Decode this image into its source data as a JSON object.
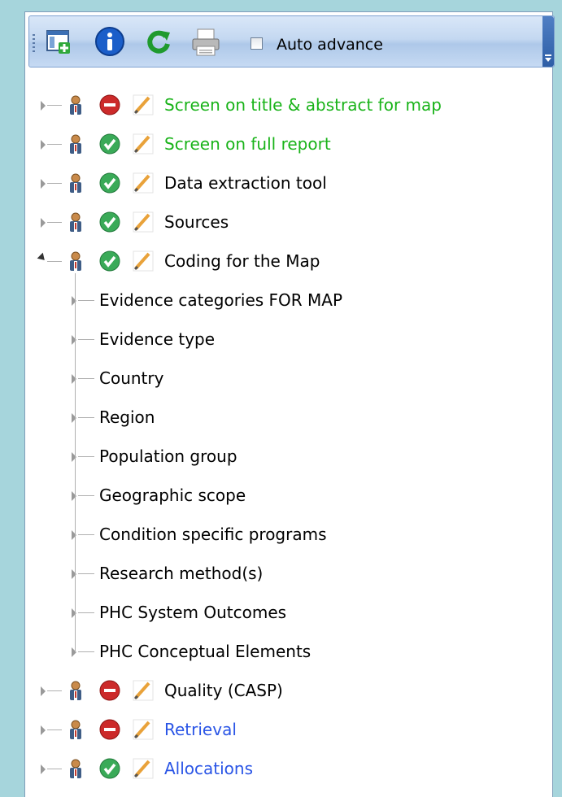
{
  "toolbar": {
    "grip_icon": "toolbar-grip-icon",
    "add_window_icon": "add-window-icon",
    "info_icon": "info-icon",
    "refresh_icon": "refresh-icon",
    "print_icon": "print-icon",
    "auto_advance_label": "Auto advance",
    "auto_advance_checked": false,
    "overflow_icon": "overflow-icon"
  },
  "colors": {
    "green_text": "#19b319",
    "blue_text": "#2a55e6",
    "black_text": "#000000"
  },
  "tree": {
    "top_items": [
      {
        "label": "Screen on title & abstract for map",
        "status": "stop",
        "color": "green",
        "expanded": false
      },
      {
        "label": "Screen on full report",
        "status": "ok",
        "color": "green",
        "expanded": false
      },
      {
        "label": "Data extraction tool",
        "status": "ok",
        "color": "black",
        "expanded": false
      },
      {
        "label": "Sources",
        "status": "ok",
        "color": "black",
        "expanded": false
      },
      {
        "label": "Coding for the Map",
        "status": "ok",
        "color": "black",
        "expanded": true
      }
    ],
    "children": [
      "Evidence categories FOR MAP",
      "Evidence type",
      "Country",
      "Region",
      "Population group",
      "Geographic scope",
      "Condition specific programs",
      "Research method(s)",
      "PHC System Outcomes",
      "PHC Conceptual Elements"
    ],
    "bottom_items": [
      {
        "label": "Quality (CASP)",
        "status": "stop",
        "color": "black",
        "expanded": false
      },
      {
        "label": "Retrieval",
        "status": "stop",
        "color": "blue",
        "expanded": false
      },
      {
        "label": "Allocations",
        "status": "ok",
        "color": "blue",
        "expanded": false
      }
    ]
  }
}
